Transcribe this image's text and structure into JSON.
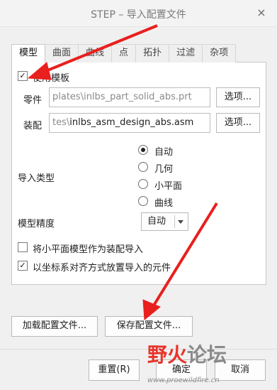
{
  "window": {
    "title": "STEP – 导入配置文件",
    "close_glyph": "×"
  },
  "tabs": [
    {
      "label": "模型"
    },
    {
      "label": "曲面"
    },
    {
      "label": "曲线"
    },
    {
      "label": "点"
    },
    {
      "label": "拓扑"
    },
    {
      "label": "过滤"
    },
    {
      "label": "杂项"
    }
  ],
  "template": {
    "checkbox_checked": true,
    "checkbox_glyph": "✓",
    "label": "使用模板",
    "part": {
      "label": "零件",
      "value": "plates\\inlbs_part_solid_abs.prt",
      "button": "选项..."
    },
    "assembly": {
      "label": "装配",
      "value_greyed": "tes\\",
      "value": "inlbs_asm_design_abs.asm",
      "button": "选项..."
    }
  },
  "import_type": {
    "label": "导入类型",
    "options": [
      {
        "label": "自动",
        "selected": true
      },
      {
        "label": "几何",
        "selected": false
      },
      {
        "label": "小平面",
        "selected": false
      },
      {
        "label": "曲线",
        "selected": false
      }
    ]
  },
  "model_precision": {
    "label": "模型精度",
    "value": "自动"
  },
  "options": [
    {
      "label": "将小平面模型作为装配导入",
      "checked": false
    },
    {
      "label": "以坐标系对齐方式放置导入的元件",
      "checked": true
    }
  ],
  "config_buttons": {
    "load": "加载配置文件...",
    "save": "保存配置文件..."
  },
  "footer": {
    "reset": "重置(R)",
    "ok": "确定",
    "cancel": "取消"
  },
  "watermark": {
    "text_red": "野火",
    "text_grey": "论坛",
    "url": "www.proewildfire.cn"
  },
  "colors": {
    "annotation_arrow": "#e8201e"
  }
}
